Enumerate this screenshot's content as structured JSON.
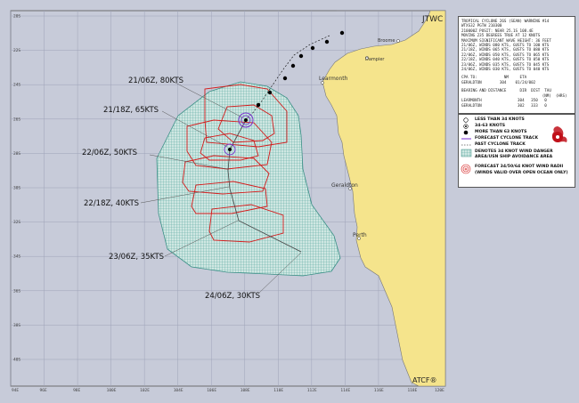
{
  "agency_label": "JTWC",
  "software_label": "ATCF®",
  "colors": {
    "ocean": "#c7cbd9",
    "land": "#f5e48c",
    "danger_hatch": "#5aa8a0",
    "track": "#000000",
    "radii": "#d41a1a",
    "current_radii": "#7a2fd0"
  },
  "lat_labels": [
    "20S",
    "22S",
    "24S",
    "26S",
    "28S",
    "30S",
    "32S",
    "34S",
    "36S",
    "38S",
    "40S"
  ],
  "lon_labels": [
    "94E",
    "96E",
    "98E",
    "100E",
    "102E",
    "104E",
    "106E",
    "108E",
    "110E",
    "112E",
    "114E",
    "116E",
    "118E",
    "120E"
  ],
  "places": [
    {
      "name": "Broome",
      "key": "broome"
    },
    {
      "name": "Dampier",
      "key": "dampier"
    },
    {
      "name": "Learmonth",
      "key": "learmonth"
    },
    {
      "name": "Geraldton",
      "key": "geraldton"
    },
    {
      "name": "Perth",
      "key": "perth"
    }
  ],
  "forecast_labels": [
    {
      "time": "21/06Z",
      "intensity": "80KTS"
    },
    {
      "time": "21/18Z",
      "intensity": "65KTS"
    },
    {
      "time": "22/06Z",
      "intensity": "50KTS"
    },
    {
      "time": "22/18Z",
      "intensity": "40KTS"
    },
    {
      "time": "23/06Z",
      "intensity": "35KTS"
    },
    {
      "time": "24/06Z",
      "intensity": "30KTS"
    }
  ],
  "info_box": {
    "lines": [
      "TROPICAL CYCLONE 26S (SEAN) WARNING #14",
      "WTXS32 PGTW 210300",
      "210000Z POSIT: NEAR 25.1S 108.4E",
      "MOVING 235 DEGREES TRUE AT 12 KNOTS",
      "MAXIMUM SIGNIFICANT WAVE HEIGHT: 36 FEET",
      "21/06Z, WINDS 080 KTS, GUSTS TO 100 KTS",
      "21/18Z, WINDS 065 KTS, GUSTS TO 080 KTS",
      "22/06Z, WINDS 050 KTS, GUSTS TO 065 KTS",
      "22/18Z, WINDS 040 KTS, GUSTS TO 050 KTS",
      "23/06Z, WINDS 035 KTS, GUSTS TO 045 KTS",
      "24/06Z, WINDS 030 KTS, GUSTS TO 040 KTS"
    ],
    "cpa_header": "CPA TO:            NM     ETA",
    "cpa_row": "GERALDTON        304    01/24/002",
    "bearing_header": "BEARING AND DISTANCE      DIR  DIST  TAU",
    "bearing_units": "                                    (NM)  (HRS)",
    "bearing_rows": [
      "LEARMONTH                304   350   0",
      "GERALDTON                302   333   0"
    ]
  },
  "legend": [
    "LESS THAN 34 KNOTS",
    "34-63 KNOTS",
    "MORE THAN 63 KNOTS",
    "FORECAST CYCLONE TRACK",
    "PAST CYCLONE TRACK",
    "DENOTES 34 KNOT WIND DANGER",
    "AREA/USN SHIP AVOIDANCE AREA",
    "FORECAST 34/50/64 KNOT WIND RADII",
    "(WINDS VALID OVER OPEN OCEAN ONLY)"
  ]
}
